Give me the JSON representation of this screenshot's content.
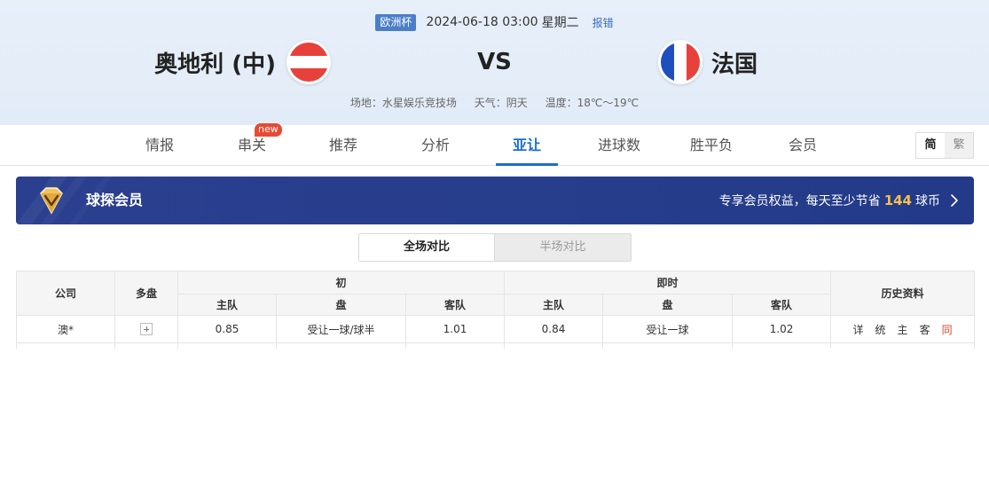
{
  "match": {
    "league": "欧洲杯",
    "datetime": "2024-06-18 03:00",
    "weekday": "星期二",
    "report_error": "报错",
    "home_team": "奥地利 (中)",
    "away_team": "法国",
    "vs": "VS",
    "venue": "场地：水星娱乐竞技场",
    "weather": "天气：阴天",
    "temperature": "温度：18℃～19℃"
  },
  "tabs": [
    {
      "label": "情报"
    },
    {
      "label": "串关",
      "badge": "new"
    },
    {
      "label": "推荐"
    },
    {
      "label": "分析"
    },
    {
      "label": "亚让",
      "active": true
    },
    {
      "label": "进球数"
    },
    {
      "label": "胜平负"
    },
    {
      "label": "会员"
    }
  ],
  "lang": {
    "simplified": "简",
    "traditional": "繁"
  },
  "member_banner": {
    "title": "球探会员",
    "promo_prefix": "专享会员权益，每天至少节省",
    "coins": "144",
    "promo_suffix": "球币"
  },
  "segment": {
    "full": "全场对比",
    "half": "半场对比"
  },
  "table": {
    "headers": {
      "company": "公司",
      "multi": "多盘",
      "initial": "初",
      "live": "即时",
      "history": "历史资料",
      "home": "主队",
      "handicap": "盘",
      "away": "客队"
    },
    "rows": [
      {
        "company": "澳*",
        "init_home": "0.85",
        "init_handicap": "受让一球/球半",
        "init_away": "1.01",
        "live_home": "0.84",
        "live_handicap": "受让一球",
        "live_away": "1.02",
        "history": [
          "详",
          "统",
          "主",
          "客",
          "同"
        ]
      }
    ]
  },
  "colors": {
    "accent": "#1a6fcf",
    "banner": "#273e8c",
    "coins": "#f5c04a",
    "new_badge": "#e84a35",
    "same_link": "#d4432a"
  },
  "icons": [
    "austria-flag-icon",
    "france-flag-icon",
    "vip-diamond-icon",
    "chevron-right-icon",
    "expand-plus-icon"
  ]
}
